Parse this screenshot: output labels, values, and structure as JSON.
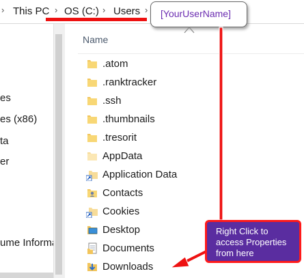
{
  "breadcrumb": {
    "items": [
      "This PC",
      "OS (C:)",
      "Users"
    ],
    "chevron": "›"
  },
  "username_callout": "[YourUserName]",
  "nav_pane": {
    "items": [
      "es",
      "es (x86)",
      "ta",
      "er",
      "ume Informa"
    ]
  },
  "column_header": "Name",
  "files": [
    {
      "name": ".atom",
      "icon": "folder-icon"
    },
    {
      "name": ".ranktracker",
      "icon": "folder-icon"
    },
    {
      "name": ".ssh",
      "icon": "folder-icon"
    },
    {
      "name": ".thumbnails",
      "icon": "folder-icon"
    },
    {
      "name": ".tresorit",
      "icon": "folder-icon"
    },
    {
      "name": "AppData",
      "icon": "folder-icon"
    },
    {
      "name": "Application Data",
      "icon": "shortcut-folder-icon"
    },
    {
      "name": "Contacts",
      "icon": "contacts-folder-icon"
    },
    {
      "name": "Cookies",
      "icon": "shortcut-folder-icon"
    },
    {
      "name": "Desktop",
      "icon": "desktop-folder-icon"
    },
    {
      "name": "Documents",
      "icon": "documents-folder-icon"
    },
    {
      "name": "Downloads",
      "icon": "downloads-folder-icon"
    }
  ],
  "annotation": {
    "lines": [
      "Right Click to",
      "access Properties",
      "from here"
    ]
  },
  "colors": {
    "highlight_red": "#ee1111",
    "callout_purple": "#5a2da0",
    "username_text": "#6a2bb0",
    "folder_yellow": "#f2c55c"
  }
}
